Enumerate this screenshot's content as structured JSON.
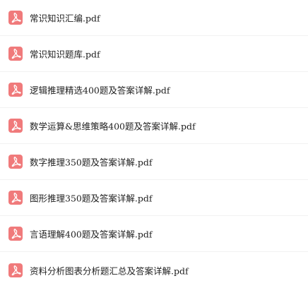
{
  "files": [
    {
      "name": "常识知识汇编.pdf",
      "icon": "pdf-file-icon"
    },
    {
      "name": "常识知识题库.pdf",
      "icon": "pdf-file-icon"
    },
    {
      "name": "逻辑推理精选400题及答案详解.pdf",
      "icon": "pdf-file-icon"
    },
    {
      "name": "数学运算&思维策略400题及答案详解.pdf",
      "icon": "pdf-file-icon"
    },
    {
      "name": "数字推理350题及答案详解.pdf",
      "icon": "pdf-file-icon"
    },
    {
      "name": "图形推理350题及答案详解.pdf",
      "icon": "pdf-file-icon"
    },
    {
      "name": "言语理解400题及答案详解.pdf",
      "icon": "pdf-file-icon"
    },
    {
      "name": "资料分析图表分析题汇总及答案详解.pdf",
      "icon": "pdf-file-icon"
    }
  ],
  "colors": {
    "icon_background": "#f07a7b",
    "icon_glyph": "#ffffff",
    "text": "#1f1f1f",
    "divider": "#f1f1f1"
  }
}
